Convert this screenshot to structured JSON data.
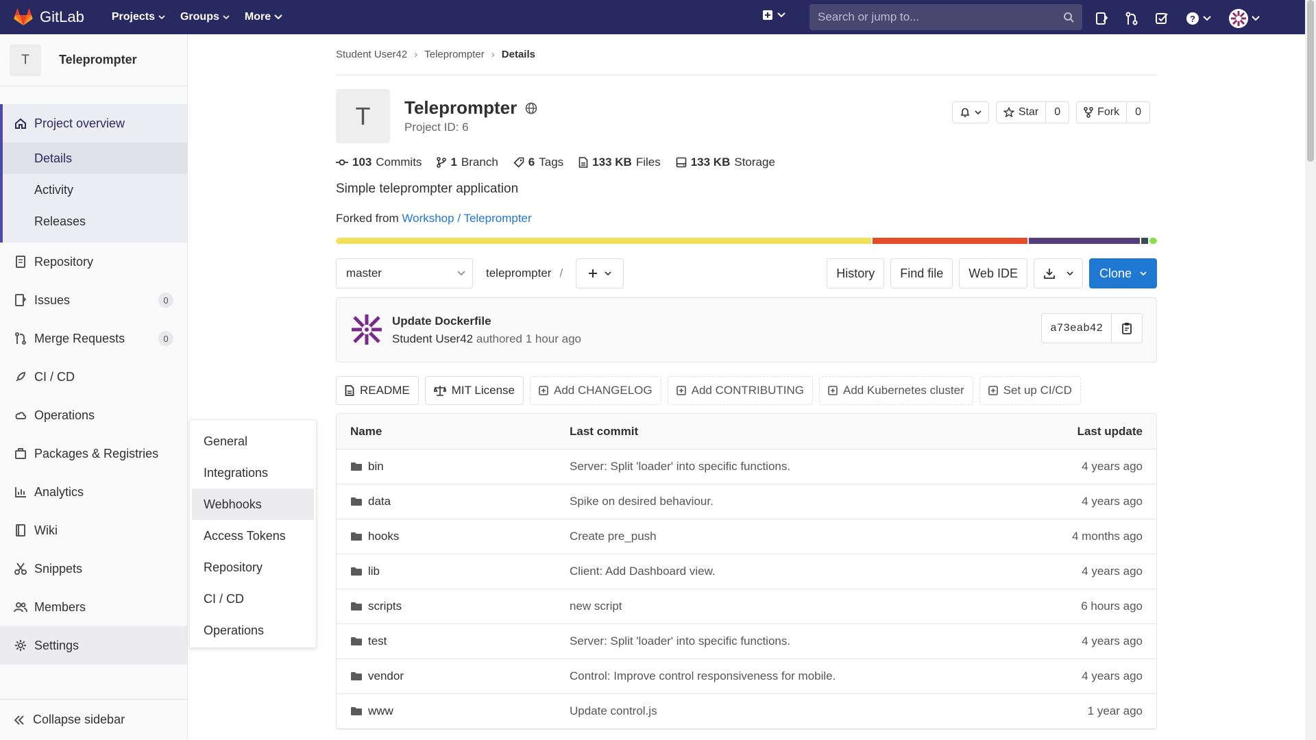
{
  "topbar": {
    "logo_text": "GitLab",
    "menu": [
      "Projects",
      "Groups",
      "More"
    ],
    "search_placeholder": "Search or jump to...",
    "bg_color": "#292961"
  },
  "sidebar": {
    "project_letter": "T",
    "project_name": "Teleprompter",
    "overview_label": "Project overview",
    "overview_items": [
      "Details",
      "Activity",
      "Releases"
    ],
    "items": {
      "repository": "Repository",
      "issues": "Issues",
      "issues_count": "0",
      "merge_requests": "Merge Requests",
      "mr_count": "0",
      "cicd": "CI / CD",
      "operations": "Operations",
      "packages": "Packages & Registries",
      "analytics": "Analytics",
      "wiki": "Wiki",
      "snippets": "Snippets",
      "members": "Members",
      "settings": "Settings"
    },
    "collapse_label": "Collapse sidebar"
  },
  "flyout": {
    "items": [
      "General",
      "Integrations",
      "Webhooks",
      "Access Tokens",
      "Repository",
      "CI / CD",
      "Operations"
    ]
  },
  "breadcrumb": {
    "user": "Student User42",
    "project": "Teleprompter",
    "current": "Details"
  },
  "project": {
    "letter": "T",
    "title": "Teleprompter",
    "id_label": "Project ID: 6",
    "star_label": "Star",
    "star_count": "0",
    "fork_label": "Fork",
    "fork_count": "0",
    "stats": {
      "commits_num": "103",
      "commits_label": "Commits",
      "branch_num": "1",
      "branch_label": "Branch",
      "tags_num": "6",
      "tags_label": "Tags",
      "files_num": "133 KB",
      "files_label": "Files",
      "storage_num": "133 KB",
      "storage_label": "Storage"
    },
    "description": "Simple teleprompter application",
    "forked_prefix": "Forked from",
    "forked_link": "Workshop / Teleprompter",
    "language_colors": [
      "#f1e05a",
      "#e34c26",
      "#563d7c",
      "#384d54",
      "#89e051"
    ]
  },
  "toolbar": {
    "branch": "master",
    "path_root": "teleprompter",
    "path_sep": "/",
    "history": "History",
    "find_file": "Find file",
    "web_ide": "Web IDE",
    "clone": "Clone"
  },
  "last_commit": {
    "title": "Update Dockerfile",
    "author": "Student User42",
    "meta": "authored 1 hour ago",
    "sha": "a73eab42"
  },
  "quick_links": {
    "readme": "README",
    "license": "MIT License",
    "changelog": "Add CHANGELOG",
    "contributing": "Add CONTRIBUTING",
    "kubernetes": "Add Kubernetes cluster",
    "cicd": "Set up CI/CD"
  },
  "tree": {
    "headers": {
      "name": "Name",
      "commit": "Last commit",
      "update": "Last update"
    },
    "rows": [
      {
        "name": "bin",
        "commit": "Server: Split 'loader' into specific functions.",
        "update": "4 years ago"
      },
      {
        "name": "data",
        "commit": "Spike on desired behaviour.",
        "update": "4 years ago"
      },
      {
        "name": "hooks",
        "commit": "Create pre_push",
        "update": "4 months ago"
      },
      {
        "name": "lib",
        "commit": "Client: Add Dashboard view.",
        "update": "4 years ago"
      },
      {
        "name": "scripts",
        "commit": "new script",
        "update": "6 hours ago"
      },
      {
        "name": "test",
        "commit": "Server: Split 'loader' into specific functions.",
        "update": "4 years ago"
      },
      {
        "name": "vendor",
        "commit": "Control: Improve control responsiveness for mobile.",
        "update": "4 years ago"
      },
      {
        "name": "www",
        "commit": "Update control.js",
        "update": "1 year ago"
      }
    ]
  }
}
